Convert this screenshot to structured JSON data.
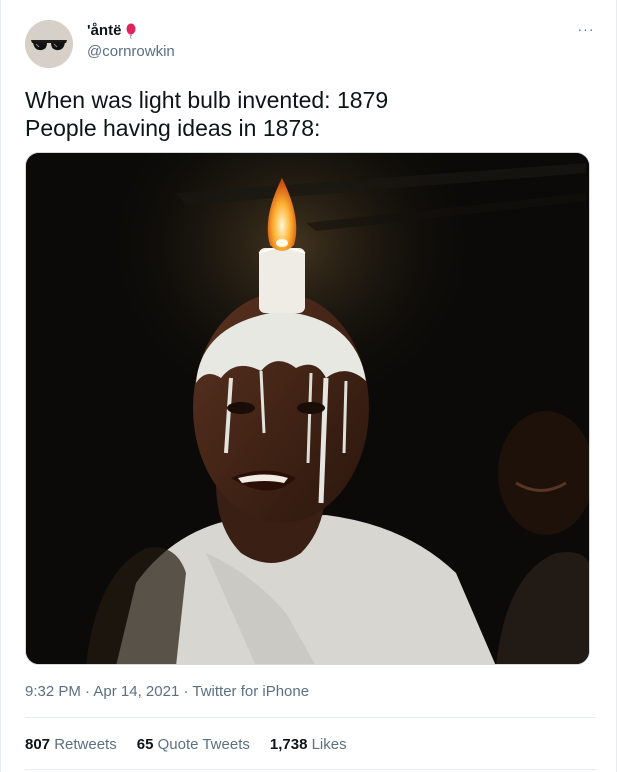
{
  "user": {
    "display_name": "'åntë",
    "handle": "@cornrowkin",
    "name_emoji_icon": "balloon-icon"
  },
  "tweet": {
    "line1": "When was light bulb invented: 1879",
    "line2": "People having ideas in 1878:"
  },
  "meta": {
    "time": "9:32 PM",
    "sep1": " · ",
    "date": "Apr 14, 2021",
    "sep2": " · ",
    "source": "Twitter for iPhone"
  },
  "stats": {
    "retweets_count": "807",
    "retweets_label": " Retweets",
    "quotes_count": "65",
    "quotes_label": " Quote Tweets",
    "likes_count": "1,738",
    "likes_label": " Likes"
  },
  "more_menu": "···",
  "colors": {
    "text": "#0f1419",
    "secondary": "#5b7083",
    "border": "#e6ecf0",
    "balloon": "#e0245e"
  }
}
